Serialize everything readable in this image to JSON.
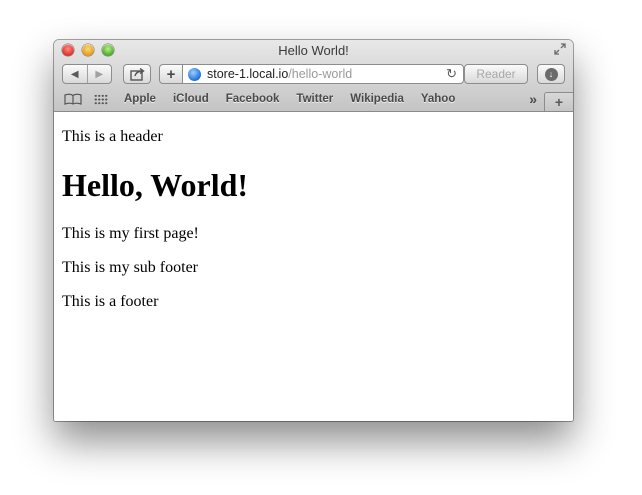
{
  "window": {
    "title": "Hello World!"
  },
  "toolbar": {
    "back_icon": "◀",
    "forward_icon": "▶",
    "share_icon": "share-icon",
    "add_label": "+",
    "url_host": "store-1.local.io",
    "url_path": "/hello-world",
    "reload_icon": "↻",
    "reader_label": "Reader",
    "download_icon": "↓"
  },
  "bookmarks": {
    "items": [
      "Apple",
      "iCloud",
      "Facebook",
      "Twitter",
      "Wikipedia",
      "Yahoo"
    ],
    "overflow_icon": "»",
    "new_tab_label": "+"
  },
  "page": {
    "header": "This is a header",
    "heading": "Hello, World!",
    "body": "This is my first page!",
    "sub_footer": "This is my sub footer",
    "footer": "This is a footer"
  },
  "colors": {
    "close": "#d9332b",
    "minimize": "#e09a1a",
    "maximize": "#4ba82a",
    "url_path": "#9a9a9a"
  }
}
